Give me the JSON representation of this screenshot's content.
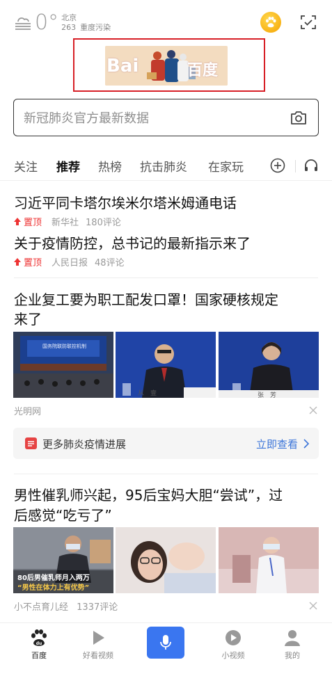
{
  "weather": {
    "temperature": "0°",
    "city": "北京",
    "aqi_value": "263",
    "aqi_label": "重度污染",
    "icon": "fog-cloud-icon"
  },
  "header": {
    "avatar_icon": "paw-icon",
    "scan_icon": "scan-icon"
  },
  "doodle": {
    "text_left": "Bai",
    "text_right": "百度"
  },
  "search": {
    "placeholder": "新冠肺炎官方最新数据",
    "camera_icon": "camera-icon"
  },
  "tabs": [
    "关注",
    "推荐",
    "热榜",
    "抗击肺炎",
    "在家玩"
  ],
  "active_tab": "推荐",
  "pinned": [
    {
      "title": "习近平同卡塔尔埃米尔塔米姆通电话",
      "tag": "置顶",
      "source": "新华社",
      "comments": "180评论"
    },
    {
      "title": "关于疫情防控，总书记的最新指示来了",
      "tag": "置顶",
      "source": "人民日报",
      "comments": "48评论"
    }
  ],
  "article1": {
    "title_line1": "企业复工要为职工配发口罩！国家硬核规定",
    "title_line2": "来了",
    "source": "光明网",
    "image_captions": [
      "国务院联防联控机制",
      "从　壹",
      "张　芳"
    ]
  },
  "more": {
    "label": "更多肺炎疫情进展",
    "link": "立即查看"
  },
  "article2": {
    "title_line1": "男性催乳师兴起，95后宝妈大胆“尝试”，过",
    "title_line2": "后感觉“吃亏了”",
    "source": "小不点育儿经",
    "comments": "1337评论",
    "overlay_line1": "80后男催乳师月入两万",
    "overlay_line2": "“男性在体力上有优势”"
  },
  "bottom_nav": [
    {
      "label": "百度",
      "icon": "baidu-paw-icon"
    },
    {
      "label": "好看视频",
      "icon": "play-icon"
    },
    {
      "label": "",
      "icon": "microphone-icon"
    },
    {
      "label": "小视频",
      "icon": "small-video-icon"
    },
    {
      "label": "我的",
      "icon": "user-icon"
    }
  ],
  "colors": {
    "accent_blue": "#3a76f0",
    "pin_red": "#e33333",
    "link_blue": "#3c75d9"
  }
}
